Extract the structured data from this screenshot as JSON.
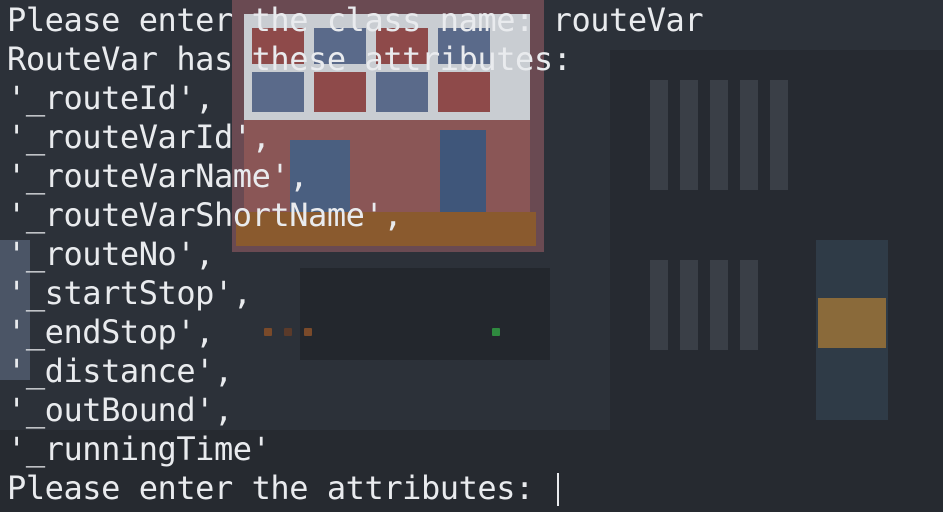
{
  "terminal": {
    "background": "#2c3139",
    "foreground": "#e9ebee",
    "prompt_class": {
      "label": "Please enter the class name: ",
      "value": "routeVar"
    },
    "header": "RouteVar has these attributes:",
    "attributes": [
      "'_routeId',",
      "'_routeVarId',",
      "'_routeVarName',",
      "'_routeVarShortName',",
      "'_routeNo',",
      "'_startStop',",
      "'_endStop',",
      "'_distance',",
      "'_outBound',",
      "'_runningTime'"
    ],
    "prompt_attributes": {
      "label": "Please enter the attributes: ",
      "value": ""
    }
  }
}
